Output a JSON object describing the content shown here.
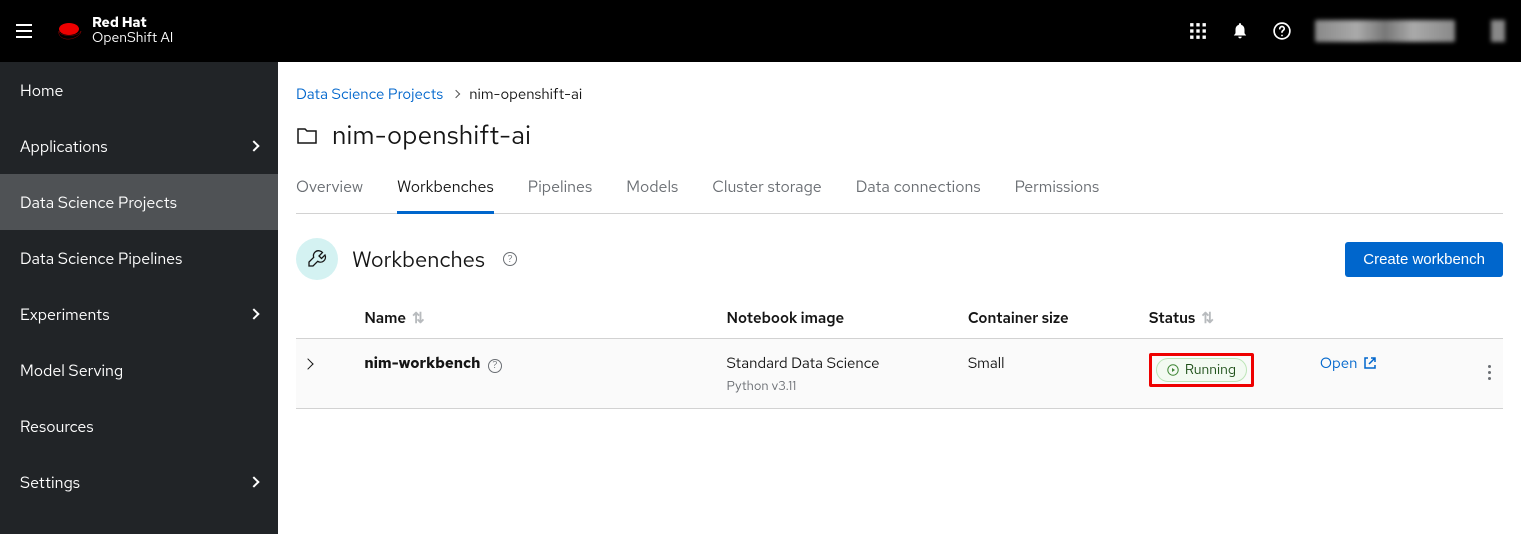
{
  "brand": {
    "line1": "Red Hat",
    "line2": "OpenShift AI"
  },
  "sidebar": {
    "items": [
      {
        "label": "Home",
        "expandable": false
      },
      {
        "label": "Applications",
        "expandable": true
      },
      {
        "label": "Data Science Projects",
        "expandable": false,
        "active": true
      },
      {
        "label": "Data Science Pipelines",
        "expandable": false
      },
      {
        "label": "Experiments",
        "expandable": true
      },
      {
        "label": "Model Serving",
        "expandable": false
      },
      {
        "label": "Resources",
        "expandable": false
      },
      {
        "label": "Settings",
        "expandable": true
      }
    ]
  },
  "breadcrumb": {
    "root": "Data Science Projects",
    "current": "nim-openshift-ai"
  },
  "page_title": "nim-openshift-ai",
  "tabs": [
    "Overview",
    "Workbenches",
    "Pipelines",
    "Models",
    "Cluster storage",
    "Data connections",
    "Permissions"
  ],
  "active_tab": "Workbenches",
  "section": {
    "title": "Workbenches",
    "create_btn": "Create workbench"
  },
  "table": {
    "columns": {
      "name": "Name",
      "notebook_image": "Notebook image",
      "container_size": "Container size",
      "status": "Status"
    },
    "rows": [
      {
        "name": "nim-workbench",
        "notebook_image": "Standard Data Science",
        "notebook_image_sub": "Python v3.11",
        "container_size": "Small",
        "status": "Running",
        "open_label": "Open"
      }
    ]
  }
}
